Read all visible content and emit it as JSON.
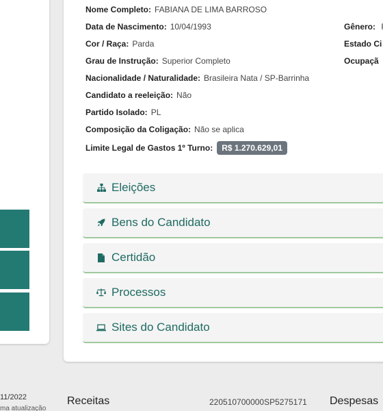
{
  "candidate": {
    "nome_label": "Nome Completo:",
    "nome_value": "FABIANA DE LIMA BARROSO",
    "nascimento_label": "Data de Nascimento:",
    "nascimento_value": "10/04/1993",
    "cor_label": "Cor / Raça:",
    "cor_value": "Parda",
    "instrucao_label": "Grau de Instrução:",
    "instrucao_value": "Superior Completo",
    "nacionalidade_label": "Nacionalidade / Naturalidade:",
    "nacionalidade_value": "Brasileira Nata / SP-Barrinha",
    "reeleicao_label": "Candidato a reeleição:",
    "reeleicao_value": "Não",
    "partido_label": "Partido Isolado:",
    "partido_value": "PL",
    "coligacao_label": "Composição da Coligação:",
    "coligacao_value": "Não se aplica",
    "limite_label": "Limite Legal de Gastos 1º Turno:",
    "limite_value": "R$ 1.270.629,01",
    "genero_label": "Gênero:",
    "genero_value": "F",
    "estado_civil_label": "Estado Ci",
    "ocupacao_label": "Ocupaçã"
  },
  "accordions": [
    {
      "label": "Eleições",
      "icon": "sitemap-icon"
    },
    {
      "label": "Bens do Candidato",
      "icon": "rocket-icon"
    },
    {
      "label": "Certidão",
      "icon": "file-icon"
    },
    {
      "label": "Processos",
      "icon": "balance-scale-icon"
    },
    {
      "label": "Sites do Candidato",
      "icon": "laptop-icon"
    }
  ],
  "footer": {
    "date": "11/2022",
    "update": "ma atualização",
    "receitas": "Receitas",
    "protocol": "220510700000SP5275171",
    "despesas": "Despesas"
  },
  "colors": {
    "accent": "#227a72",
    "accordion_text": "#1f6b63",
    "accordion_border": "#9ec89c",
    "badge": "#6c757d"
  }
}
